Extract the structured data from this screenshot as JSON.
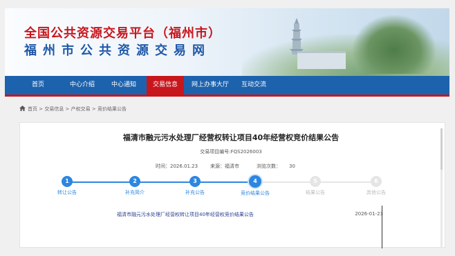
{
  "header": {
    "title_cn": "全国公共资源交易平台（福州市）",
    "subtitle_cn": "福州市公共资源交易网"
  },
  "nav": {
    "items": [
      {
        "label": "首页"
      },
      {
        "label": "中心介绍"
      },
      {
        "label": "中心通知"
      },
      {
        "label": "交易信息",
        "active": true
      },
      {
        "label": "网上办事大厅"
      },
      {
        "label": "互动交流"
      }
    ]
  },
  "breadcrumb": {
    "icon": "home-icon",
    "text": "首页 > 交易信息 > 产权交易 > 竞价结果公告"
  },
  "page": {
    "title": "福清市融元污水处理厂经营权转让项目40年经营权竞价结果公告",
    "code": "交易项目编号:FQS2026003",
    "time_label": "时间：",
    "time_value": "2026.01.23",
    "source_label": "来源：",
    "source_value": "福清市",
    "views_label": "浏览次数：",
    "views_value": "30"
  },
  "steps": [
    {
      "num": "1",
      "label": "转让公告",
      "state": "done"
    },
    {
      "num": "2",
      "label": "补充简介",
      "state": "done"
    },
    {
      "num": "3",
      "label": "补充公告",
      "state": "done"
    },
    {
      "num": "4",
      "label": "竞价结果公告",
      "state": "current"
    },
    {
      "num": "5",
      "label": "结果公告",
      "state": "todo"
    },
    {
      "num": "6",
      "label": "其他公告",
      "state": "todo"
    }
  ],
  "list": [
    {
      "title": "福清市融元污水处理厂经营权转让项目40年经营权竞价结果公告",
      "date": "2026-01-23"
    }
  ],
  "colors": {
    "brand_red": "#c8161d",
    "brand_blue": "#1d62ad",
    "step_blue": "#2d86e0"
  }
}
